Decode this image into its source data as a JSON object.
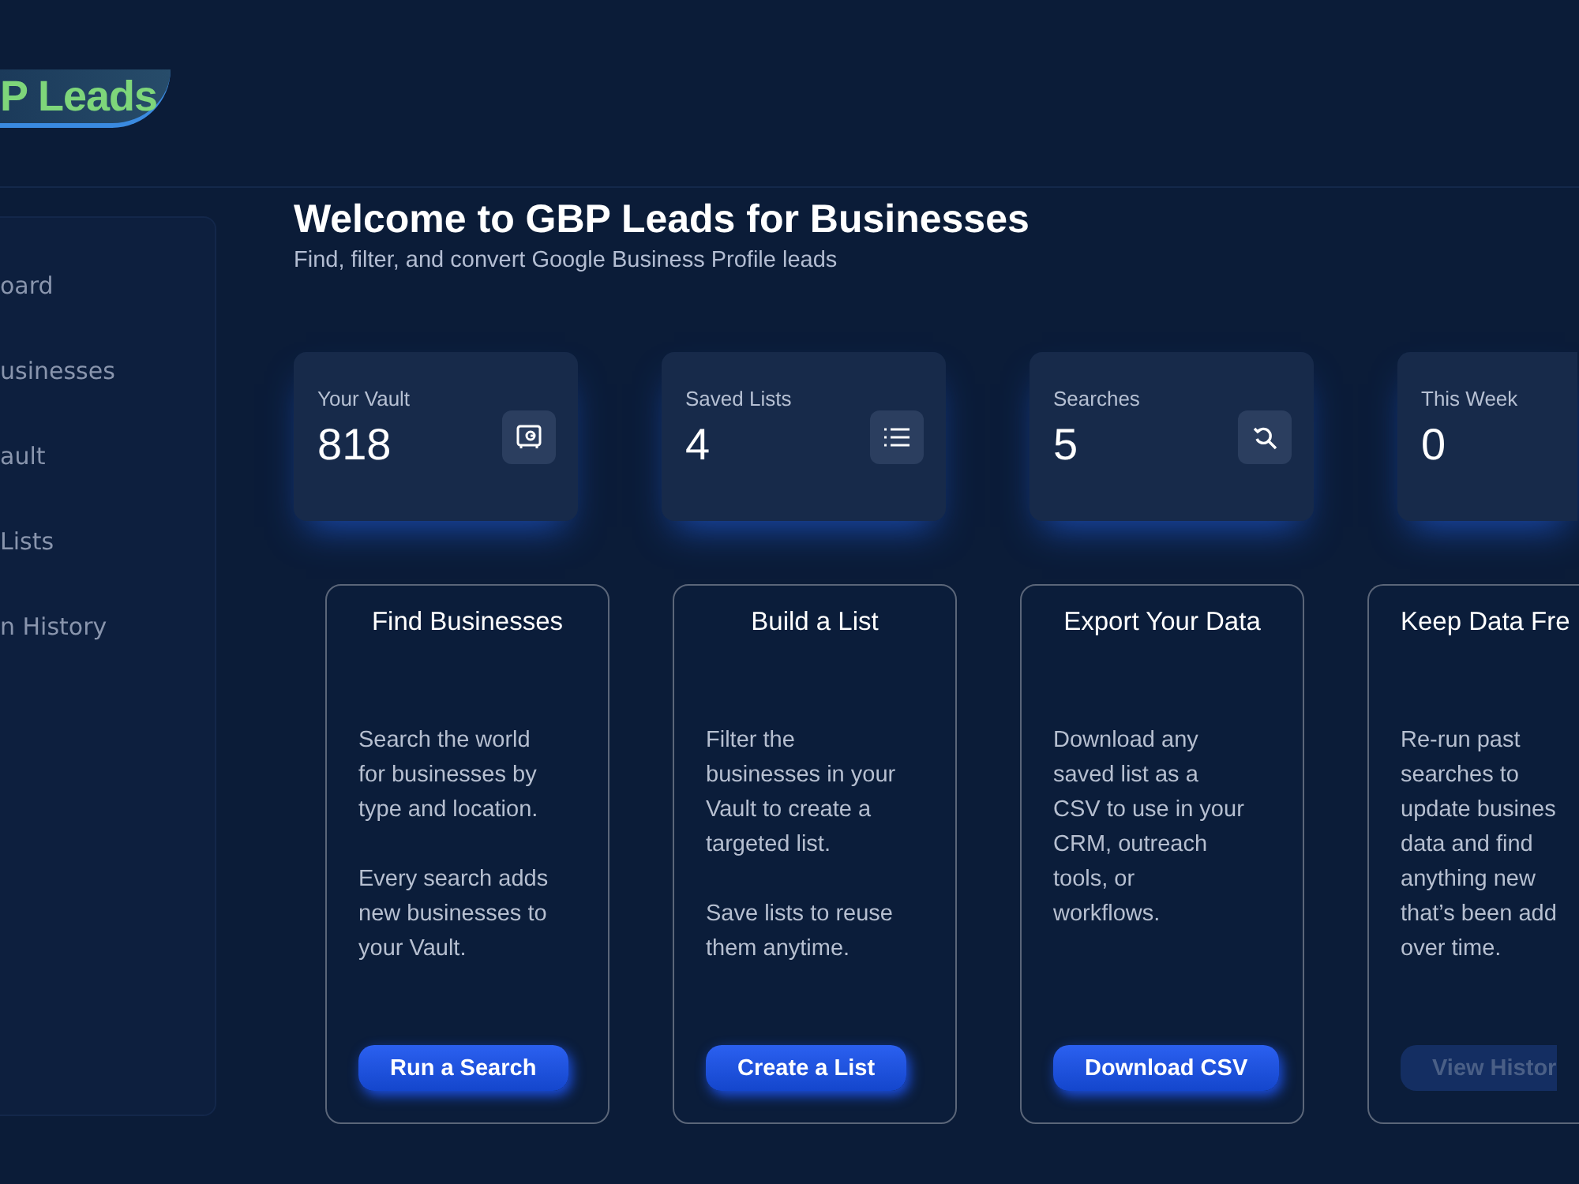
{
  "logo": {
    "text": "P Leads"
  },
  "sidebar": {
    "items": [
      {
        "label": "oard",
        "selected": false
      },
      {
        "label": "usinesses",
        "selected": false
      },
      {
        "label": "ault",
        "selected": false
      },
      {
        "label": "Lists",
        "selected": false
      },
      {
        "label": "n History",
        "selected": false
      }
    ]
  },
  "header": {
    "title": "Welcome to GBP Leads for Businesses",
    "subtitle": "Find, filter, and convert Google Business Profile leads"
  },
  "stats": [
    {
      "label": "Your Vault",
      "value": "818",
      "kind": "vault"
    },
    {
      "label": "Saved Lists",
      "value": "4",
      "kind": "list"
    },
    {
      "label": "Searches",
      "value": "5",
      "kind": "search"
    },
    {
      "label": "This Week",
      "value": "0",
      "kind": "plain"
    }
  ],
  "features": [
    {
      "title": "Find Businesses",
      "paragraphs": [
        [
          "Search the world",
          "for businesses by",
          "type and location."
        ],
        [
          "Every search adds",
          "new businesses to",
          "your Vault."
        ]
      ],
      "button": {
        "label": "Run a Search",
        "disabled": false
      }
    },
    {
      "title": "Build a List",
      "paragraphs": [
        [
          "Filter the",
          "businesses in your",
          "Vault to create a",
          "targeted list."
        ],
        [
          "Save lists to reuse",
          "them anytime."
        ]
      ],
      "button": {
        "label": "Create a List",
        "disabled": false
      }
    },
    {
      "title": "Export Your Data",
      "paragraphs": [
        [
          "Download any",
          "saved list as a",
          "CSV to use in your",
          "CRM, outreach",
          "tools, or",
          "workflows."
        ]
      ],
      "button": {
        "label": "Download CSV",
        "disabled": false
      }
    },
    {
      "title": "Keep Data Fre",
      "paragraphs": [
        [
          "Re-run past",
          "searches to",
          "update busines",
          "data and find",
          "anything new",
          "that’s been add",
          "over time."
        ]
      ],
      "button": {
        "label": "View Histor",
        "disabled": true
      }
    }
  ]
}
